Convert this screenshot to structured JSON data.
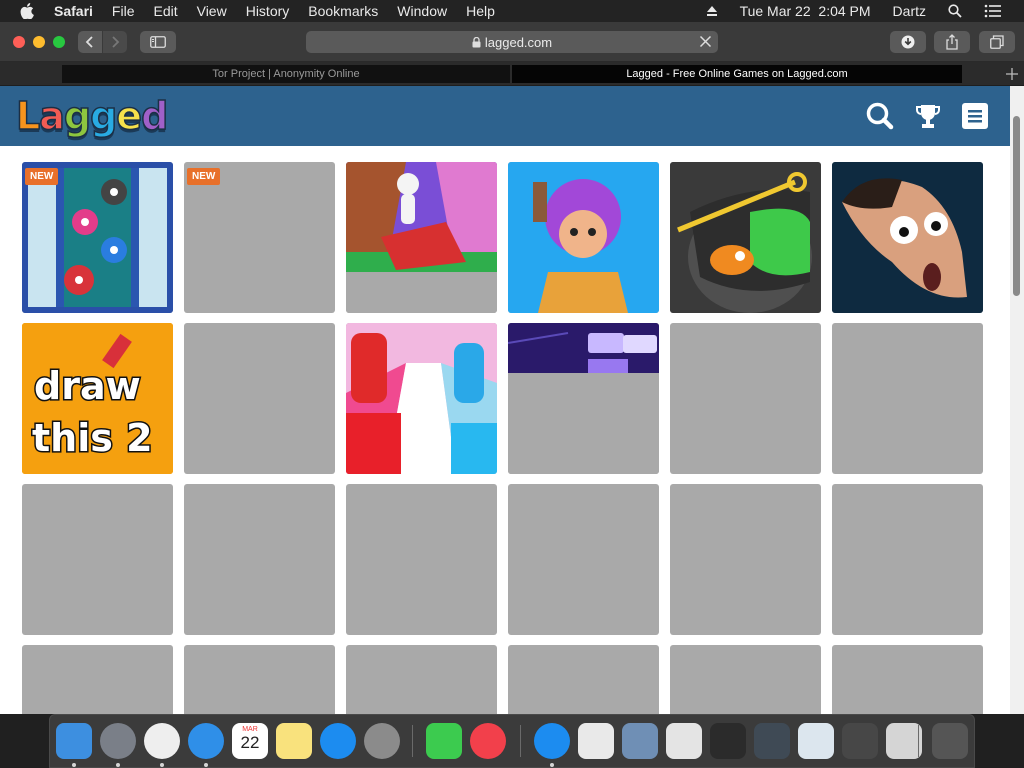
{
  "menubar": {
    "app_name": "Safari",
    "items": [
      "File",
      "Edit",
      "View",
      "History",
      "Bookmarks",
      "Window",
      "Help"
    ],
    "datetime": "Tue Mar 22  2:04 PM",
    "user": "Dartz"
  },
  "toolbar": {
    "address": "lagged.com"
  },
  "tabs": [
    {
      "title": "Tor Project | Anonymity Online",
      "active": false
    },
    {
      "title": "Lagged - Free Online Games on Lagged.com",
      "active": true
    }
  ],
  "site": {
    "logo_letters": [
      {
        "char": "L",
        "color": "#f7941d"
      },
      {
        "char": "a",
        "color": "#f25c54"
      },
      {
        "char": "g",
        "color": "#8dc63f"
      },
      {
        "char": "g",
        "color": "#29abe2"
      },
      {
        "char": "e",
        "color": "#f6e14b"
      },
      {
        "char": "d",
        "color": "#a060c8"
      }
    ],
    "logo_text": "Lagged",
    "header_color": "#2d628e",
    "badge_color": "#e8702a",
    "placeholder_color": "#a9a9a9",
    "tiles": [
      {
        "badge": "NEW",
        "art": "pigs"
      },
      {
        "badge": "NEW",
        "art": "placeholder"
      },
      {
        "badge": "",
        "art": "mower"
      },
      {
        "badge": "",
        "art": "brawler"
      },
      {
        "badge": "",
        "art": "fish"
      },
      {
        "badge": "",
        "art": "face"
      },
      {
        "badge": "",
        "art": "draw",
        "art_text": [
          "draw",
          "this 2"
        ]
      },
      {
        "badge": "",
        "art": "placeholder"
      },
      {
        "badge": "",
        "art": "runner"
      },
      {
        "badge": "",
        "art": "tiles"
      },
      {
        "badge": "",
        "art": "placeholder"
      },
      {
        "badge": "",
        "art": "placeholder"
      },
      {
        "badge": "",
        "art": "placeholder"
      },
      {
        "badge": "",
        "art": "placeholder"
      },
      {
        "badge": "",
        "art": "placeholder"
      },
      {
        "badge": "",
        "art": "placeholder"
      },
      {
        "badge": "",
        "art": "placeholder"
      },
      {
        "badge": "",
        "art": "placeholder"
      },
      {
        "badge": "",
        "art": "placeholder"
      },
      {
        "badge": "",
        "art": "placeholder"
      },
      {
        "badge": "",
        "art": "placeholder"
      },
      {
        "badge": "",
        "art": "placeholder"
      },
      {
        "badge": "",
        "art": "placeholder"
      },
      {
        "badge": "",
        "art": "placeholder"
      }
    ]
  },
  "dock": {
    "apps": [
      {
        "name": "finder",
        "color": "#3d8fe0",
        "running": true
      },
      {
        "name": "launchpad",
        "color": "#7a7f88",
        "running": true
      },
      {
        "name": "chrome",
        "color": "#eeeeee",
        "running": true
      },
      {
        "name": "safari",
        "color": "#2f8fe8",
        "running": true
      },
      {
        "name": "calendar",
        "color": "#ffffff",
        "running": false,
        "label_month": "MAR",
        "label_day": "22"
      },
      {
        "name": "notes",
        "color": "#f9e27d",
        "running": false
      },
      {
        "name": "app-store",
        "color": "#1c8cf0",
        "running": false
      },
      {
        "name": "system-preferences",
        "color": "#8b8b8b",
        "running": false
      },
      {
        "name": "facetime",
        "color": "#3ccb4f",
        "running": false
      },
      {
        "name": "news",
        "color": "#f2404b",
        "running": false
      },
      {
        "name": "app-store-downloads",
        "color": "#1c8cf0",
        "running": true
      },
      {
        "name": "safari-download",
        "color": "#e9e9e9",
        "running": false
      },
      {
        "name": "window-thumb-1",
        "color": "#6f8fb5",
        "running": false
      },
      {
        "name": "window-thumb-2",
        "color": "#e4e4e4",
        "running": false
      },
      {
        "name": "window-thumb-3",
        "color": "#2b2b2b",
        "running": false
      },
      {
        "name": "window-thumb-4",
        "color": "#3f4a55",
        "running": false
      },
      {
        "name": "window-thumb-5",
        "color": "#dce6ee",
        "running": false
      },
      {
        "name": "window-thumb-6",
        "color": "#474747",
        "running": false
      },
      {
        "name": "window-thumb-7",
        "color": "#d5d5d5",
        "running": false
      },
      {
        "name": "trash",
        "color": "#555555",
        "running": false
      }
    ]
  }
}
